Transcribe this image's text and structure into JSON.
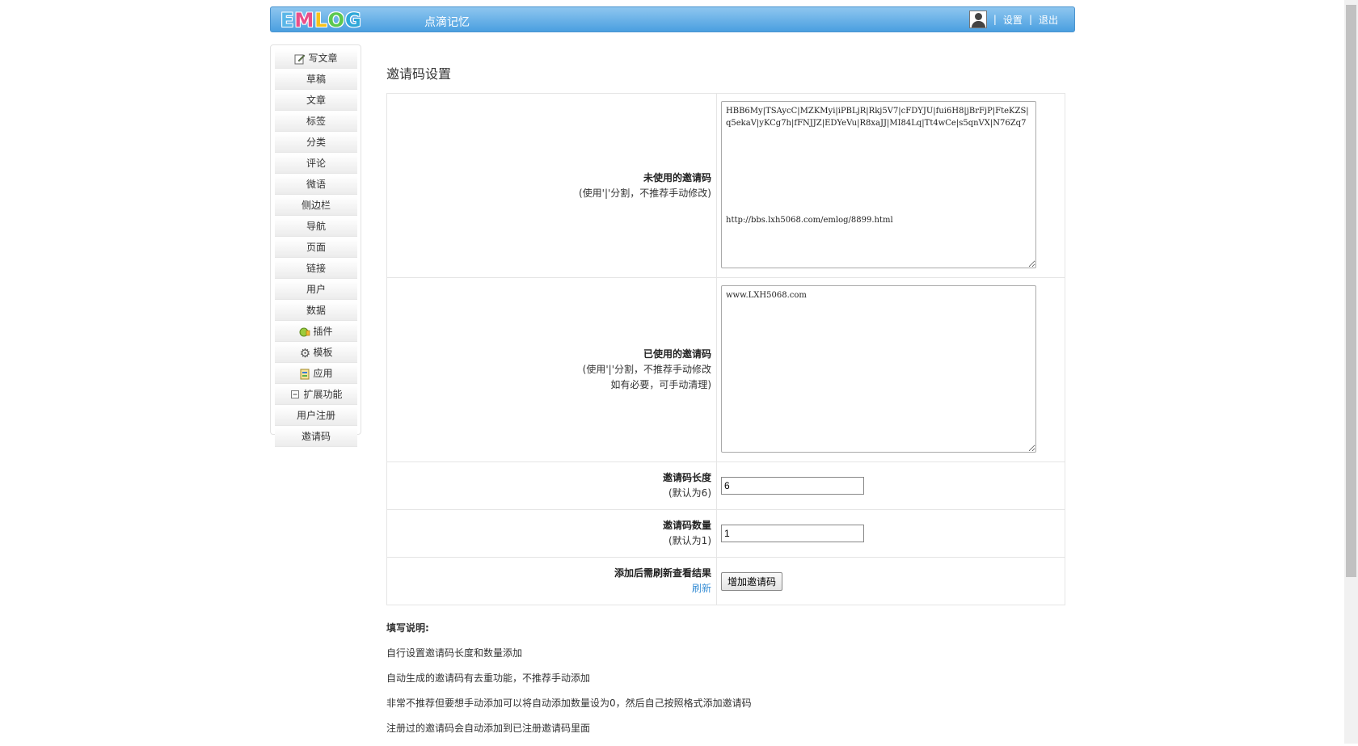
{
  "header": {
    "logo_letters": [
      "E",
      "M",
      "L",
      "O",
      "G"
    ],
    "site_name": "点滴记忆",
    "settings_label": "设置",
    "logout_label": "退出",
    "separator": "|"
  },
  "sidebar": {
    "items": [
      {
        "label": "写文章",
        "icon": "edit-icon"
      },
      {
        "label": "草稿"
      },
      {
        "label": "文章"
      },
      {
        "label": "标签"
      },
      {
        "label": "分类"
      },
      {
        "label": "评论"
      },
      {
        "label": "微语"
      },
      {
        "label": "侧边栏"
      },
      {
        "label": "导航"
      },
      {
        "label": "页面"
      },
      {
        "label": "链接"
      },
      {
        "label": "用户"
      },
      {
        "label": "数据"
      },
      {
        "label": "插件",
        "icon": "plugin-icon"
      },
      {
        "label": "模板",
        "icon": "gear-icon"
      },
      {
        "label": "应用",
        "icon": "app-icon"
      },
      {
        "label": "扩展功能",
        "icon": "collapse-icon"
      },
      {
        "label": "用户注册"
      },
      {
        "label": "邀请码"
      }
    ]
  },
  "main": {
    "title": "邀请码设置",
    "unused": {
      "label": "未使用的邀请码",
      "hint": "(使用'|'分割，不推荐手动修改)",
      "value": "HBB6My|TSAycC|MZKMyi|iPBLjR|Rkj5V7|cFDYJU|fui6H8|jBrFjP|FteKZS|q5ekaV|yKCg7h|fFNJJZ|EDYeVu|R8xaJJ|MI84Lq|Tt4wCe|s5qnVX|N76Zq7\n\n\n\n\n\n\n\nhttp://bbs.lxh5068.com/emlog/8899.html"
    },
    "used": {
      "label": "已使用的邀请码",
      "hint1": "(使用'|'分割，不推荐手动修改",
      "hint2": "如有必要，可手动清理)",
      "value": "www.LXH5068.com"
    },
    "length": {
      "label": "邀请码长度",
      "hint": "(默认为6)",
      "value": "6"
    },
    "count": {
      "label": "邀请码数量",
      "hint": "(默认为1)",
      "value": "1"
    },
    "add": {
      "label": "添加后需刷新查看结果",
      "refresh": "刷新",
      "button": "增加邀请码"
    }
  },
  "notes": {
    "title": "填写说明:",
    "lines": [
      "自行设置邀请码长度和数量添加",
      "自动生成的邀请码有去重功能，不推荐手动添加",
      "非常不推荐但要想手动添加可以将自动添加数量设为0，然后自己按照格式添加邀请码",
      "注册过的邀请码会自动添加到已注册邀请码里面"
    ]
  },
  "colors": {
    "header_top": "#8ec6ef",
    "header_bottom": "#4a9fe0",
    "link": "#3a8fd5",
    "logo": [
      "#5ab6e8",
      "#e94f8a",
      "#f7c21b",
      "#5cc84f",
      "#2fa8d8"
    ]
  }
}
